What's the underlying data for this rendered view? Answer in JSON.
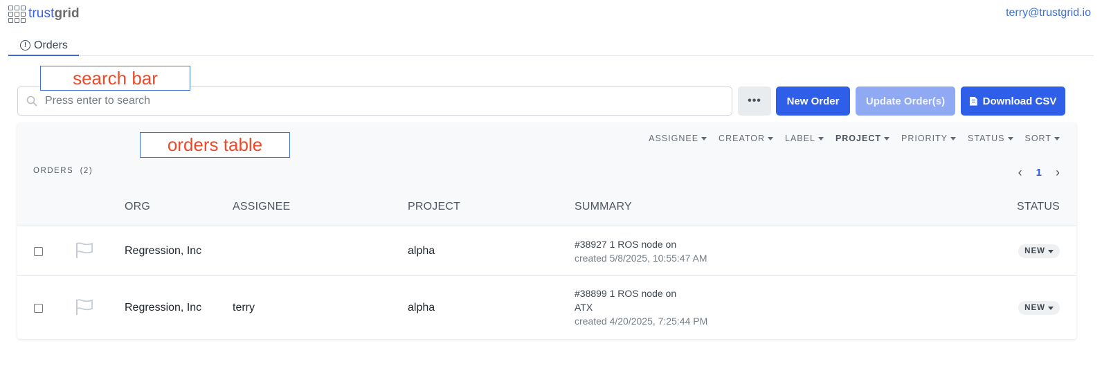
{
  "brand": {
    "name_part1": "trust",
    "name_part2": "grid"
  },
  "user": {
    "email": "terry@trustgrid.io"
  },
  "tabs": [
    {
      "label": "Orders",
      "icon": "alert-circle-icon"
    }
  ],
  "annotations": {
    "search": "search bar",
    "table": "orders table"
  },
  "search": {
    "placeholder": "Press enter to search"
  },
  "toolbar": {
    "more_label": "•••",
    "new_order_label": "New Order",
    "update_label": "Update Order(s)",
    "download_label": "Download CSV"
  },
  "filters": [
    "ASSIGNEE",
    "CREATOR",
    "LABEL",
    "PROJECT",
    "PRIORITY",
    "STATUS",
    "SORT"
  ],
  "orders": {
    "title": "ORDERS",
    "count": "(2)"
  },
  "pagination": {
    "prev": "‹",
    "current": "1",
    "next": "›"
  },
  "columns": {
    "org": "ORG",
    "assignee": "ASSIGNEE",
    "project": "PROJECT",
    "summary": "SUMMARY",
    "status": "STATUS"
  },
  "rows": [
    {
      "org": "Regression, Inc",
      "assignee": "",
      "project": "alpha",
      "summary_lines": [
        "#38927 1 ROS node on"
      ],
      "created": "created 5/8/2025, 10:55:47 AM",
      "status": "NEW"
    },
    {
      "org": "Regression, Inc",
      "assignee": "terry",
      "project": "alpha",
      "summary_lines": [
        "#38899 1 ROS node on",
        "ATX"
      ],
      "created": "created 4/20/2025, 7:25:44 PM",
      "status": "NEW"
    }
  ],
  "colors": {
    "primary": "#2f5ee8",
    "primary_disabled": "#8fa9f2",
    "annotation_text": "#ee4a2a",
    "annotation_border": "#3d6fe0"
  }
}
